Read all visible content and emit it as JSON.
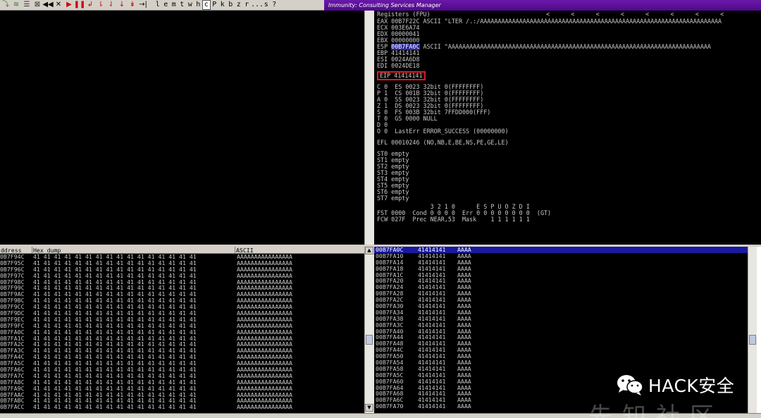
{
  "toolbar": {
    "icons": [
      "step-into-icon",
      "plugin-icon",
      "log-icon",
      "memory-icon",
      "rewind-icon",
      "close-icon",
      "run-icon",
      "pause-icon",
      "step-red-icon",
      "trace-into-icon",
      "trace-over-icon",
      "animate-into-icon",
      "animate-over-icon",
      "execute-till-return-icon"
    ],
    "icon_glyphs": [
      "⤵",
      "≋",
      "☰",
      "⊠",
      "◀◀",
      "✕",
      "▶",
      "❚❚",
      "↲",
      "⇂",
      "⇃",
      "↓",
      "↡",
      "→|"
    ],
    "letters": [
      "l",
      "e",
      "m",
      "t",
      "w",
      "h",
      "c",
      "P",
      "k",
      "b",
      "z",
      "r",
      "...",
      "s",
      "?"
    ],
    "selected_letter": "c"
  },
  "window": {
    "title": "Immunity: Consulting Services Manager"
  },
  "registers": {
    "header": "Registers (FPU)",
    "arrows": "<      <      <      <      <      <      <      <",
    "lines_a": [
      "EAX 00B7F22C ASCII \"LTER /.:/AAAAAAAAAAAAAAAAAAAAAAAAAAAAAAAAAAAAAAAAAAAAAAAAAAAAAAAAAAAAAAAAAAAA",
      "ECX 003E6A74",
      "EDX 00000041",
      "EBX 00000000"
    ],
    "esp_label": "ESP ",
    "esp_value": "00B7FA0C",
    "esp_rest": " ASCII \"AAAAAAAAAAAAAAAAAAAAAAAAAAAAAAAAAAAAAAAAAAAAAAAAAAAAAAAAAAAAAAAAAAAAAAAAAA",
    "lines_b": [
      "EBP 41414141",
      "ESI 0024A6D8",
      "EDI 0024DE18"
    ],
    "eip": "EIP 41414141",
    "flags": [
      "C 0  ES 0023 32bit 0(FFFFFFFF)",
      "P 1  CS 001B 32bit 0(FFFFFFFF)",
      "A 0  SS 0023 32bit 0(FFFFFFFF)",
      "Z 1  DS 0023 32bit 0(FFFFFFFF)",
      "S 0  FS 003B 32bit 7FFDD000(FFF)",
      "T 0  GS 0000 NULL",
      "D 0",
      "O 0  LastErr ERROR_SUCCESS (00000000)"
    ],
    "efl": "EFL 00010246 (NO,NB,E,BE,NS,PE,GE,LE)",
    "fpu": [
      "ST0 empty",
      "ST1 empty",
      "ST2 empty",
      "ST3 empty",
      "ST4 empty",
      "ST5 empty",
      "ST6 empty",
      "ST7 empty"
    ],
    "fst_header": "               3 2 1 0      E S P U O Z D I",
    "fst": "FST 0000  Cond 0 0 0 0  Err 0 0 0 0 0 0 0 0  (GT)",
    "fcw": "FCW 027F  Prec NEAR,53  Mask    1 1 1 1 1 1"
  },
  "dump": {
    "col_address": "ddress",
    "col_hex": "Hex dump",
    "col_ascii": "ASCII",
    "hex": "41 41 41 41 41 41 41 41 41 41 41 41 41 41 41 41",
    "ascii": "AAAAAAAAAAAAAAAA",
    "addresses": [
      "0B7F94C",
      "0B7F95C",
      "0B7F96C",
      "0B7F97C",
      "0B7F98C",
      "0B7F99C",
      "0B7F9AC",
      "0B7F9BC",
      "0B7F9CC",
      "0B7F9DC",
      "0B7F9EC",
      "0B7F9FC",
      "0B7FA0C",
      "0B7FA1C",
      "0B7FA2C",
      "0B7FA3C",
      "0B7FA4C",
      "0B7FA5C",
      "0B7FA6C",
      "0B7FA7C",
      "0B7FA8C",
      "0B7FA9C",
      "0B7FAAC",
      "0B7FABC",
      "0B7FACC"
    ]
  },
  "stack": {
    "value": "41414141",
    "ascii": "AAAA",
    "addresses": [
      "00B7FA0C",
      "00B7FA10",
      "00B7FA14",
      "00B7FA18",
      "00B7FA1C",
      "00B7FA20",
      "00B7FA24",
      "00B7FA28",
      "00B7FA2C",
      "00B7FA30",
      "00B7FA34",
      "00B7FA38",
      "00B7FA3C",
      "00B7FA40",
      "00B7FA44",
      "00B7FA48",
      "00B7FA4C",
      "00B7FA50",
      "00B7FA54",
      "00B7FA58",
      "00B7FA5C",
      "00B7FA60",
      "00B7FA64",
      "00B7FA68",
      "00B7FA6C",
      "00B7FA70"
    ]
  },
  "watermark": {
    "text": "HACK安全",
    "text2": "先知社区"
  }
}
